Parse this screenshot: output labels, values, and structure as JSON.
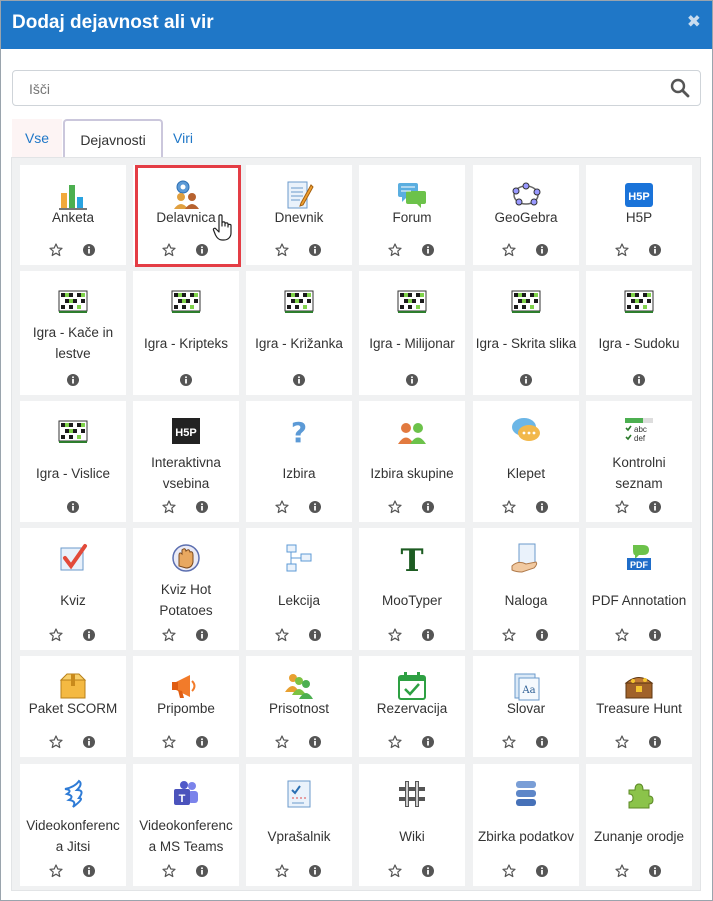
{
  "dialog": {
    "title": "Dodaj dejavnost ali vir",
    "close_icon": "close-icon",
    "search_placeholder": "Išči"
  },
  "tabs": [
    {
      "label": "Vse"
    },
    {
      "label": "Dejavnosti"
    },
    {
      "label": "Viri"
    }
  ],
  "colors": {
    "accent": "#1f77c7",
    "highlight": "#e43d45"
  },
  "modules": [
    {
      "line1": "Anketa",
      "line2": "",
      "icon": "chart-icon",
      "star": true
    },
    {
      "line1": "Delavnica",
      "line2": "",
      "icon": "workshop-icon",
      "star": true
    },
    {
      "line1": "Dnevnik",
      "line2": "",
      "icon": "journal-icon",
      "star": true
    },
    {
      "line1": "Forum",
      "line2": "",
      "icon": "forum-icon",
      "star": true
    },
    {
      "line1": "GeoGebra",
      "line2": "",
      "icon": "geogebra-icon",
      "star": true
    },
    {
      "line1": "H5P",
      "line2": "",
      "icon": "h5p-icon",
      "star": true
    },
    {
      "line1": "Igra - Kače in",
      "line2": "lestve",
      "icon": "game-icon",
      "star": false
    },
    {
      "line1": "Igra - Kripteks",
      "line2": "",
      "icon": "game-icon",
      "star": false
    },
    {
      "line1": "Igra - Križanka",
      "line2": "",
      "icon": "game-icon",
      "star": false
    },
    {
      "line1": "Igra - Milijonar",
      "line2": "",
      "icon": "game-icon",
      "star": false
    },
    {
      "line1": "Igra - Skrita slika",
      "line2": "",
      "icon": "game-icon",
      "star": false
    },
    {
      "line1": "Igra - Sudoku",
      "line2": "",
      "icon": "game-icon",
      "star": false
    },
    {
      "line1": "Igra - Vislice",
      "line2": "",
      "icon": "game-icon",
      "star": false
    },
    {
      "line1": "Interaktivna",
      "line2": "vsebina",
      "icon": "h5p-dark-icon",
      "star": true
    },
    {
      "line1": "Izbira",
      "line2": "",
      "icon": "question-icon",
      "star": true
    },
    {
      "line1": "Izbira skupine",
      "line2": "",
      "icon": "group-choice-icon",
      "star": true
    },
    {
      "line1": "Klepet",
      "line2": "",
      "icon": "chat-icon",
      "star": true
    },
    {
      "line1": "Kontrolni",
      "line2": "seznam",
      "icon": "checklist-icon",
      "star": true
    },
    {
      "line1": "Kviz",
      "line2": "",
      "icon": "quiz-icon",
      "star": true
    },
    {
      "line1": "Kviz Hot",
      "line2": "Potatoes",
      "icon": "hotpot-icon",
      "star": true
    },
    {
      "line1": "Lekcija",
      "line2": "",
      "icon": "lesson-icon",
      "star": true
    },
    {
      "line1": "MooTyper",
      "line2": "",
      "icon": "mootyper-icon",
      "star": true
    },
    {
      "line1": "Naloga",
      "line2": "",
      "icon": "assignment-icon",
      "star": true
    },
    {
      "line1": "PDF Annotation",
      "line2": "",
      "icon": "pdf-icon",
      "star": true
    },
    {
      "line1": "Paket SCORM",
      "line2": "",
      "icon": "scorm-icon",
      "star": true
    },
    {
      "line1": "Pripombe",
      "line2": "",
      "icon": "feedback-icon",
      "star": true
    },
    {
      "line1": "Prisotnost",
      "line2": "",
      "icon": "attendance-icon",
      "star": true
    },
    {
      "line1": "Rezervacija",
      "line2": "",
      "icon": "scheduler-icon",
      "star": true
    },
    {
      "line1": "Slovar",
      "line2": "",
      "icon": "glossary-icon",
      "star": true
    },
    {
      "line1": "Treasure Hunt",
      "line2": "",
      "icon": "treasure-icon",
      "star": true
    },
    {
      "line1": "Videokonferenc",
      "line2": "a Jitsi",
      "icon": "jitsi-icon",
      "star": true
    },
    {
      "line1": "Videokonferenc",
      "line2": "a MS Teams",
      "icon": "teams-icon",
      "star": true
    },
    {
      "line1": "Vprašalnik",
      "line2": "",
      "icon": "questionnaire-icon",
      "star": true
    },
    {
      "line1": "Wiki",
      "line2": "",
      "icon": "wiki-icon",
      "star": true
    },
    {
      "line1": "Zbirka podatkov",
      "line2": "",
      "icon": "database-icon",
      "star": true
    },
    {
      "line1": "Zunanje orodje",
      "line2": "",
      "icon": "external-tool-icon",
      "star": true
    }
  ]
}
